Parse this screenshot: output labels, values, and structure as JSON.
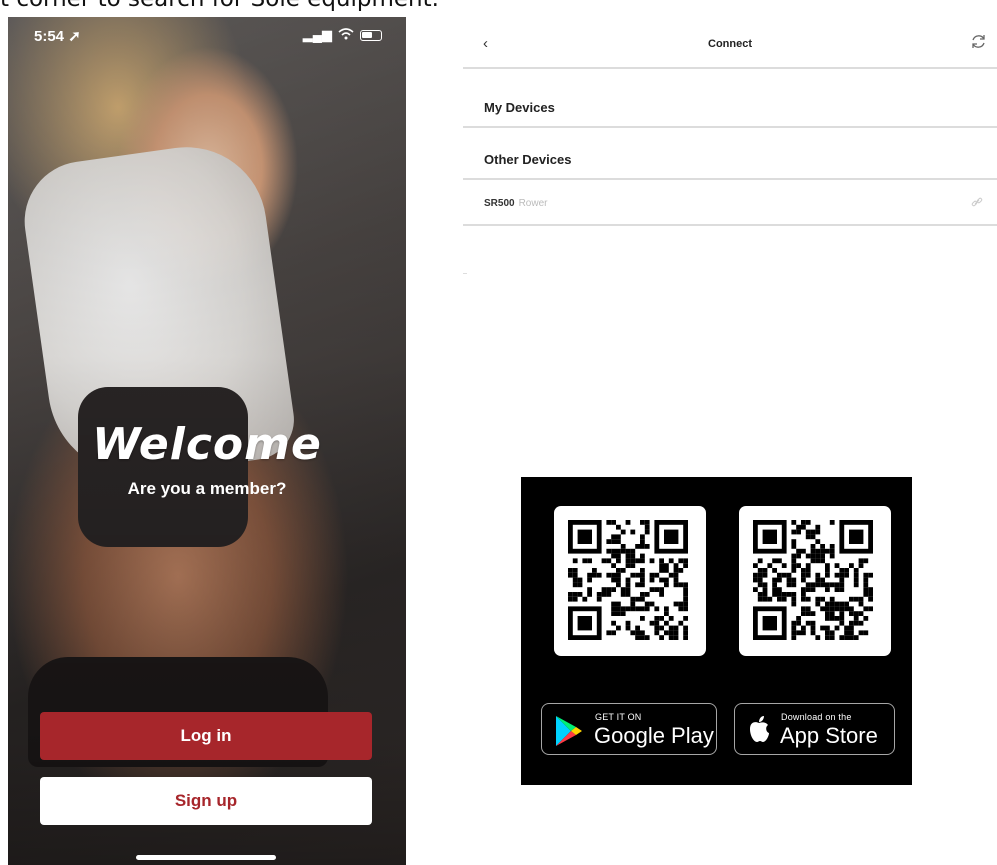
{
  "caption": "t corner to search for Sole equipment.",
  "phone": {
    "status_time": "5:54 ➚",
    "welcome_title": "Welcome",
    "member_prompt": "Are you a member?",
    "login_label": "Log in",
    "signup_label": "Sign up"
  },
  "connect": {
    "back_icon": "‹",
    "title": "Connect",
    "refresh_icon": "refresh-icon",
    "my_devices_label": "My Devices",
    "other_devices_label": "Other Devices",
    "devices": [
      {
        "name": "SR500",
        "type": "Rower",
        "icon": "link-icon"
      }
    ]
  },
  "stores": {
    "google_small": "GET IT ON",
    "google_big": "Google Play",
    "apple_small": "Download on the",
    "apple_big": "App Store"
  },
  "colors": {
    "brand_red": "#a7262b",
    "divider": "#dcdcdc"
  }
}
